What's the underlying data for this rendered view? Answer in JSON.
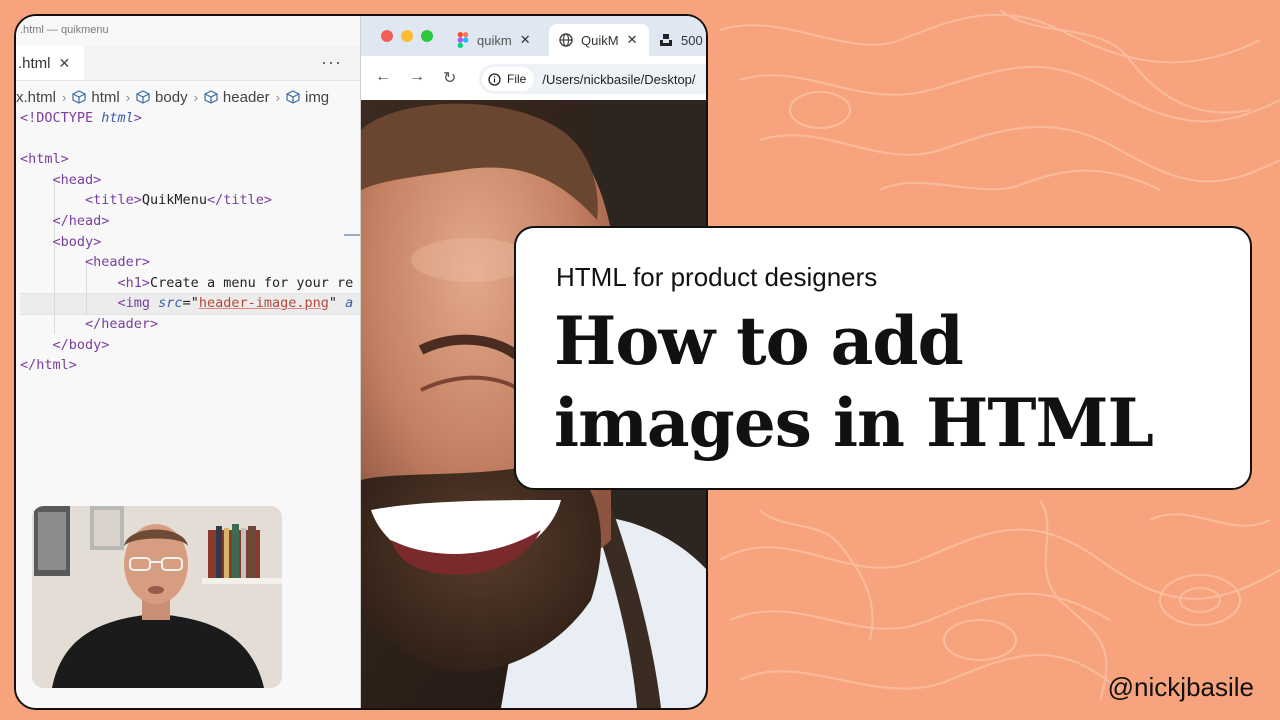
{
  "editor": {
    "window_title": ".html — quikmenu",
    "tab_label": ".html",
    "breadcrumb": [
      "x.html",
      "html",
      "body",
      "header",
      "img"
    ],
    "code_lines": [
      {
        "parts": [
          {
            "c": "t",
            "s": "<!DOCTYPE "
          },
          {
            "c": "ita",
            "s": "html"
          },
          {
            "c": "t",
            "s": ">"
          }
        ]
      },
      {
        "parts": []
      },
      {
        "parts": [
          {
            "c": "t",
            "s": "<html>"
          }
        ]
      },
      {
        "parts": [
          {
            "c": "t",
            "s": "    <head>"
          }
        ]
      },
      {
        "parts": [
          {
            "c": "t",
            "s": "        <title>"
          },
          {
            "c": "txt",
            "s": "QuikMenu"
          },
          {
            "c": "t",
            "s": "</title>"
          }
        ]
      },
      {
        "parts": [
          {
            "c": "t",
            "s": "    </head>"
          }
        ]
      },
      {
        "parts": [
          {
            "c": "t",
            "s": "    <body>"
          }
        ]
      },
      {
        "parts": [
          {
            "c": "t",
            "s": "        <header>"
          }
        ]
      },
      {
        "parts": [
          {
            "c": "t",
            "s": "            <h1>"
          },
          {
            "c": "txt",
            "s": "Create a menu for your re"
          }
        ]
      },
      {
        "parts": [
          {
            "c": "t",
            "s": "            <img "
          },
          {
            "c": "ita",
            "s": "src"
          },
          {
            "c": "txt",
            "s": "=\""
          },
          {
            "c": "str",
            "s": "header-image.png"
          },
          {
            "c": "txt",
            "s": "\" "
          },
          {
            "c": "ita",
            "s": "a"
          }
        ]
      },
      {
        "parts": [
          {
            "c": "t",
            "s": "        </header>"
          }
        ]
      },
      {
        "parts": [
          {
            "c": "t",
            "s": "    </body>"
          }
        ]
      },
      {
        "parts": [
          {
            "c": "t",
            "s": "</html>"
          }
        ]
      }
    ]
  },
  "browser": {
    "tabs": [
      {
        "label": "quikm"
      },
      {
        "label": "QuikM"
      },
      {
        "label": "500"
      }
    ],
    "security_chip": "File",
    "url": "/Users/nickbasile/Desktop/"
  },
  "card": {
    "subtitle": "HTML for product designers",
    "headline_line1": "How to add",
    "headline_line2": "images in HTML"
  },
  "handle": "@nickjbasile",
  "colors": {
    "background": "#f7a47e",
    "topo_lines": "#fbc2a6",
    "frame": "#111111",
    "tag_purple": "#7a3e9d",
    "attr_blue": "#3a5fa8",
    "string_red": "#b5473a"
  }
}
